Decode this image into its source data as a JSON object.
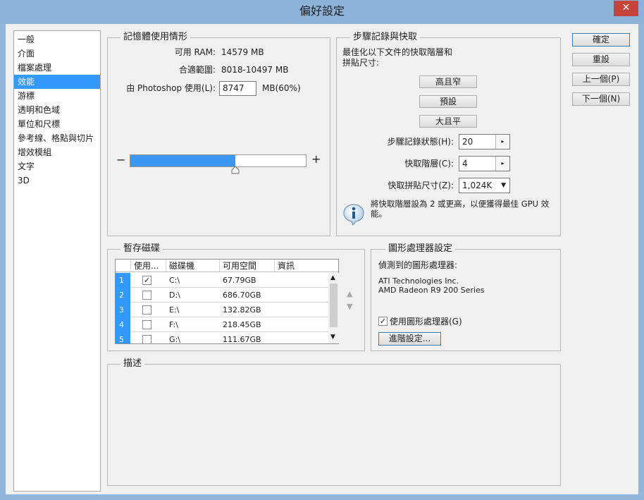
{
  "window": {
    "title": "偏好設定",
    "close_glyph": "✕"
  },
  "nav": {
    "items": [
      "一般",
      "介面",
      "檔案處理",
      "效能",
      "游標",
      "透明和色域",
      "單位和尺標",
      "參考線、格點與切片",
      "增效模組",
      "文字",
      "3D"
    ],
    "selected_index": 3
  },
  "memory": {
    "title": "記憶體使用情形",
    "available_label": "可用 RAM:",
    "available_value": "14579 MB",
    "ideal_label": "合適範圍:",
    "ideal_value": "8018-10497 MB",
    "let_use_label": "由 Photoshop 使用(L):",
    "let_use_value": "8747",
    "let_use_unit": "MB(60%)",
    "slider_percent": 60,
    "minus": "−",
    "plus": "+"
  },
  "history": {
    "title": "步驟記錄與快取",
    "desc": "最佳化以下文件的快取階層和\n拼貼尺寸:",
    "btn_tall": "高且窄",
    "btn_default": "預設",
    "btn_big": "大且平",
    "states_label": "步驟記錄狀態(H):",
    "states_value": "20",
    "levels_label": "快取階層(C):",
    "levels_value": "4",
    "tile_label": "快取拼貼尺寸(Z):",
    "tile_value": "1,024K",
    "info_text": "將快取階層設為 2 或更高，以便獲得最佳 GPU 效\n能。"
  },
  "scratch": {
    "title": "暫存磁碟",
    "columns": [
      "使用...",
      "磁碟機",
      "可用空間",
      "資訊"
    ],
    "rows": [
      {
        "num": "1",
        "checked": true,
        "drive": "C:\\",
        "free": "67.79GB"
      },
      {
        "num": "2",
        "checked": false,
        "drive": "D:\\",
        "free": "686.70GB"
      },
      {
        "num": "3",
        "checked": false,
        "drive": "E:\\",
        "free": "132.82GB"
      },
      {
        "num": "4",
        "checked": false,
        "drive": "F:\\",
        "free": "218.45GB"
      },
      {
        "num": "5",
        "checked": false,
        "drive": "G:\\",
        "free": "111.67GB"
      }
    ]
  },
  "gpu": {
    "title": "圖形處理器設定",
    "detected_label": "偵測到的圖形處理器:",
    "vendor": "ATI Technologies Inc.",
    "model": "AMD Radeon R9 200 Series",
    "use_label": "使用圖形處理器(G)",
    "use_checked": true,
    "advanced_btn": "進階設定..."
  },
  "description": {
    "title": "描述"
  },
  "buttons": {
    "ok": "確定",
    "reset": "重設",
    "prev": "上一個(P)",
    "next": "下一個(N)"
  },
  "icons": {
    "info": "info-icon",
    "check": "✓"
  },
  "colors": {
    "accent": "#3399ff",
    "title_bar": "#8db3da",
    "close": "#c7443a"
  }
}
